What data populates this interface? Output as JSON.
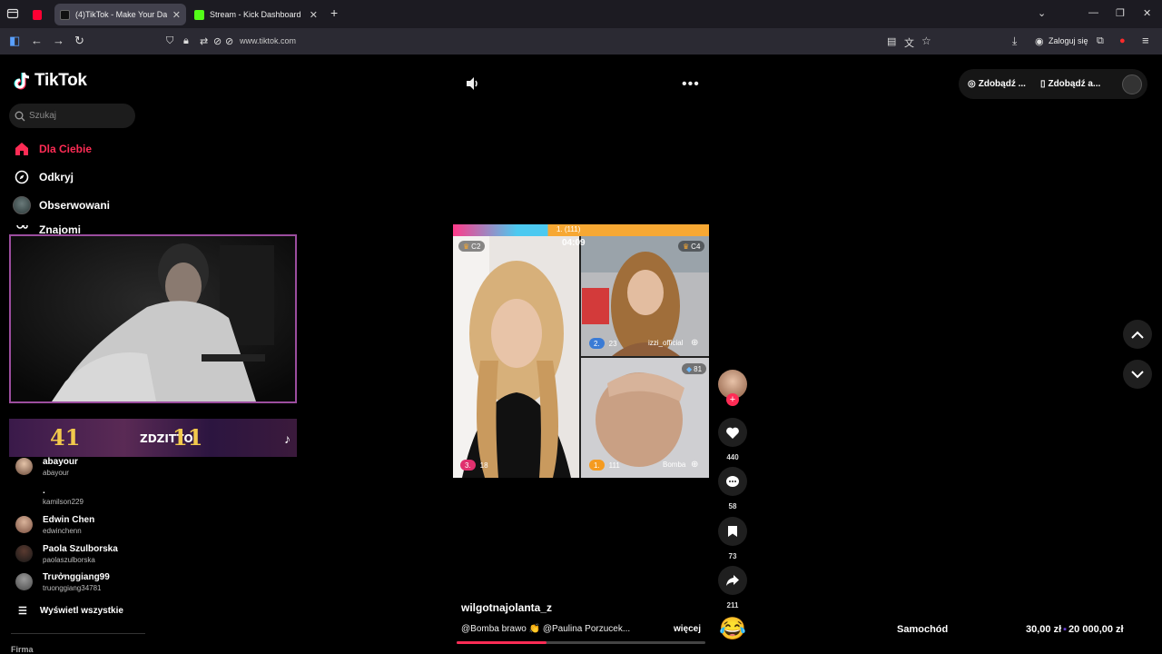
{
  "browser": {
    "tabs": [
      {
        "label": "(4)TikTok - Make Your Day",
        "active": true
      },
      {
        "label": "Stream - Kick Dashboard",
        "active": false
      }
    ],
    "url": "www.tiktok.com",
    "login_label": "Zaloguj się"
  },
  "sidebar": {
    "logo": "TikTok",
    "search_placeholder": "Szukaj",
    "nav": [
      {
        "label": "Dla Ciebie",
        "icon": "home-icon"
      },
      {
        "label": "Odkryj",
        "icon": "compass-icon"
      },
      {
        "label": "Obserwowani",
        "icon": "following-avatar-icon"
      },
      {
        "label": "Znajomi",
        "icon": "friends-icon"
      }
    ],
    "following": [
      {
        "name": "abayour",
        "handle": "abayour"
      },
      {
        "name": ".",
        "handle": "kamilson229"
      },
      {
        "name": "Edwin Chen",
        "handle": "edwinchenn"
      },
      {
        "name": "Paola Szulborska",
        "handle": "paolaszulborska"
      },
      {
        "name": "Trưởnggiang99",
        "handle": "truonggiang34781"
      }
    ],
    "show_all": "Wyświetl wszystkie",
    "footer": "Firma"
  },
  "overlay": {
    "banner_left": "41",
    "banner_name": "ZDZITTO",
    "banner_right": "11"
  },
  "video": {
    "top_label": "1. (111)",
    "timer": "04:09",
    "tags": [
      "C2",
      "C4",
      "81"
    ],
    "ranks": [
      {
        "pos": "2.",
        "score": "23",
        "name": "izzi_official"
      },
      {
        "pos": "3.",
        "score": "18",
        "name": ""
      },
      {
        "pos": "1.",
        "score": "111",
        "name": "Bomba"
      }
    ],
    "author": "wilgotnajolanta_z",
    "caption": "@Bomba  brawo 👏 @Paulina Porzucek...",
    "more": "więcej",
    "progress": 0.36
  },
  "top_right": {
    "btn1": "Zdobądź ...",
    "btn2": "Zdobądź a..."
  },
  "actions": {
    "likes": "440",
    "comments": "58",
    "saves": "73",
    "shares": "211"
  },
  "ticker": {
    "item": "Samochód",
    "price_left": "30,00 zł",
    "price_right": "20 000,00 zł"
  },
  "colors": {
    "accent": "#fe2c55",
    "overlay_border": "#9b4d9e"
  }
}
